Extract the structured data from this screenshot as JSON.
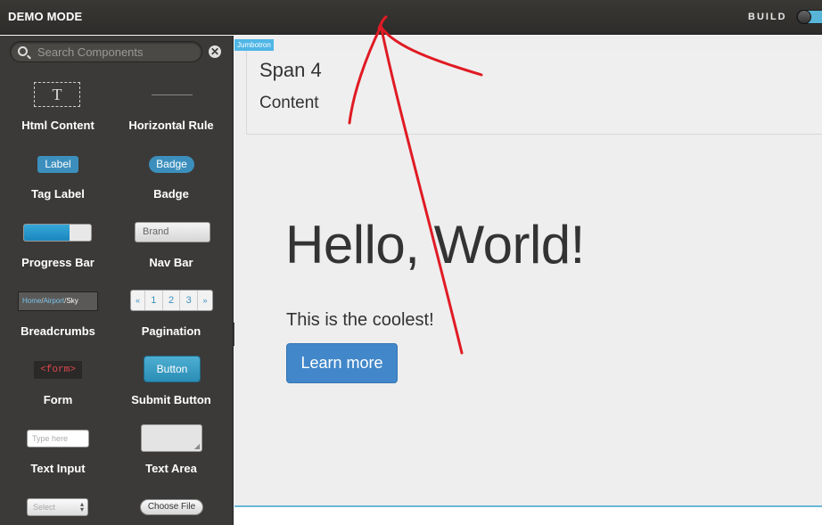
{
  "topbar": {
    "title": "DEMO MODE",
    "mode_label": "BUILD",
    "icons": [
      "toggle-switch-icon"
    ]
  },
  "sidebar": {
    "search_placeholder": "Search Components",
    "icons": [
      "search-icon",
      "clear-icon",
      "collapse-handle-icon"
    ],
    "components": [
      {
        "label": "Html Content",
        "preview": "T"
      },
      {
        "label": "Horizontal Rule",
        "preview": ""
      },
      {
        "label": "Tag Label",
        "preview": "Label"
      },
      {
        "label": "Badge",
        "preview": "Badge"
      },
      {
        "label": "Progress Bar",
        "preview": "",
        "progress": 0.68
      },
      {
        "label": "Nav Bar",
        "preview": "Brand"
      },
      {
        "label": "Breadcrumbs",
        "preview_items": [
          "Home",
          "Airport",
          "Sky"
        ],
        "preview_separator": "/"
      },
      {
        "label": "Pagination",
        "preview_items": [
          "«",
          "1",
          "2",
          "3",
          "»"
        ]
      },
      {
        "label": "Form",
        "preview": "<form>"
      },
      {
        "label": "Submit Button",
        "preview": "Button"
      },
      {
        "label": "Text Input",
        "preview": "Type here"
      },
      {
        "label": "Text Area",
        "preview": ""
      },
      {
        "label": "",
        "preview": "Select"
      },
      {
        "label": "",
        "preview": "Choose File"
      }
    ]
  },
  "canvas": {
    "jumbotron_tag": "Jumbotron",
    "span_title": "Span 4",
    "span_content": "Content",
    "hero_title": "Hello, World!",
    "hero_subtitle": "This is the coolest!",
    "hero_button": "Learn more"
  },
  "colors": {
    "topbar": "#2e2c2a",
    "sidebar": "#3b3a38",
    "accent": "#4fb6e6",
    "primary_button": "#4287c9",
    "annotation": "#e01b24"
  }
}
